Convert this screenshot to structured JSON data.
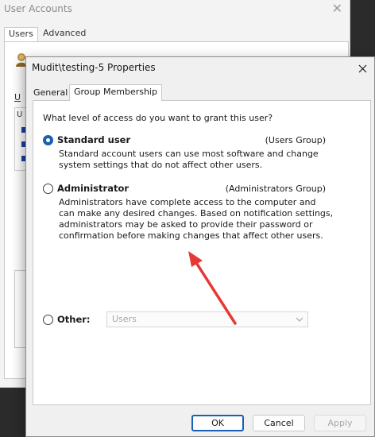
{
  "background_window": {
    "title": "User Accounts",
    "tabs": [
      {
        "label": "Users",
        "active": true
      },
      {
        "label": "Advanced",
        "active": false
      }
    ],
    "partial_label": "U"
  },
  "dialog": {
    "title": "Mudit\\testing-5 Properties",
    "tabs": [
      {
        "label": "General",
        "active": false
      },
      {
        "label": "Group Membership",
        "active": true
      }
    ],
    "question": "What level of access do you want to grant this user?",
    "options": [
      {
        "label": "Standard user",
        "group": "(Users Group)",
        "checked": true,
        "description": [
          "Standard account users can use most software and change",
          "system settings that do not affect other users."
        ]
      },
      {
        "label": "Administrator",
        "group": "(Administrators Group)",
        "checked": false,
        "description": [
          "Administrators have complete access to the computer and",
          "can make any desired changes. Based on notification settings,",
          "administrators may be asked to provide their password or",
          "confirmation before making changes that affect other users."
        ]
      },
      {
        "label": "Other:",
        "checked": false,
        "select_value": "Users"
      }
    ],
    "buttons": {
      "ok": "OK",
      "cancel": "Cancel",
      "apply": "Apply"
    }
  },
  "colors": {
    "accent": "#1a5fb4",
    "arrow": "#e53935"
  },
  "icons": [
    "close-icon",
    "user-avatar-icon",
    "chevron-down-icon",
    "annotation-arrow"
  ]
}
